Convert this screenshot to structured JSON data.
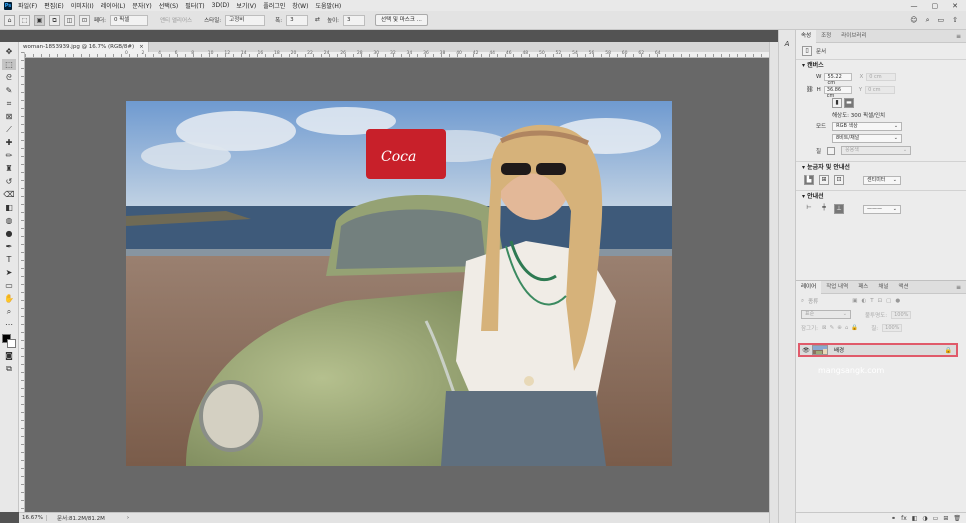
{
  "menubar": {
    "app_icon": "Ps",
    "items": [
      "파일(F)",
      "편집(E)",
      "이미지(I)",
      "레이어(L)",
      "문자(Y)",
      "선택(S)",
      "필터(T)",
      "3D(D)",
      "보기(V)",
      "플러그인",
      "창(W)",
      "도움말(H)"
    ],
    "controls": [
      "—",
      "▢",
      "✕"
    ]
  },
  "options": {
    "feather_label": "페더:",
    "feather_value": "0 픽셀",
    "antialias_label": "앤티 앨리어스",
    "style_label": "스타일:",
    "style_value": "고정비",
    "width_label": "폭:",
    "width_value": "3",
    "height_label": "높이:",
    "height_value": "3",
    "select_mask_button": "선택 및 마스크 ..."
  },
  "document": {
    "tab_title": "woman-1853939.jpg @ 16.7% (RGB/8#)",
    "tab_close": "×",
    "ruler_marks": [
      "0",
      "2",
      "4",
      "6",
      "8",
      "10",
      "12",
      "14",
      "16",
      "18",
      "20",
      "22",
      "24",
      "26",
      "28",
      "30",
      "32",
      "34",
      "36",
      "38",
      "40",
      "42",
      "44",
      "46",
      "48",
      "50",
      "52",
      "54",
      "56",
      "58",
      "60",
      "62",
      "64"
    ],
    "zoom": "16.67%",
    "doc_info": "문서:81.2M/81.2M",
    "status_arrow": "›"
  },
  "properties": {
    "tabs": [
      "속성",
      "조정",
      "라이브러리"
    ],
    "doc_label": "문서",
    "canvas_title": "캔버스",
    "w_label": "W",
    "w_value": "55.22 cm",
    "x_label": "X",
    "x_value": "0 cm",
    "h_label": "H",
    "h_value": "36.86 cm",
    "y_label": "Y",
    "y_value": "0 cm",
    "resolution": "해상도: 300 픽셀/인치",
    "mode_label": "모드",
    "mode_value": "RGB 색상",
    "depth_value": "8비트/채널",
    "fill_label": "응용색",
    "rulers_title": "눈금자 및 안내선",
    "rulers_unit": "센티미터",
    "guides_title": "안내선"
  },
  "layers": {
    "tabs": [
      "레이어",
      "작업 내역",
      "패스",
      "채널",
      "액션"
    ],
    "kind_label": "종류",
    "blend_mode": "표준",
    "opacity_label": "불투명도:",
    "opacity_value": "100%",
    "lock_label": "잠그기:",
    "fill_label": "칠:",
    "fill_value": "100%",
    "layer_name": "배경",
    "watermark": "mangsangk.com",
    "bottom_icons": [
      "⚭",
      "fx",
      "◧",
      "◑",
      "▭",
      "⊞",
      "🗑"
    ]
  },
  "colors": {
    "accent_highlight": "#e05a6a",
    "canvas_bg": "#686868"
  }
}
